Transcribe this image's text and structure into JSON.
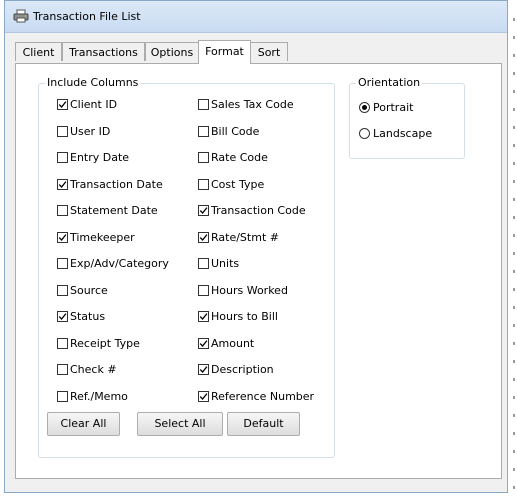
{
  "window": {
    "title": "Transaction File List"
  },
  "tabs": [
    {
      "label": "Client",
      "active": false
    },
    {
      "label": "Transactions",
      "active": false
    },
    {
      "label": "Options",
      "active": false
    },
    {
      "label": "Format",
      "active": true
    },
    {
      "label": "Sort",
      "active": false
    }
  ],
  "include_columns": {
    "legend": "Include Columns",
    "left": [
      {
        "label": "Client ID",
        "checked": true
      },
      {
        "label": "User ID",
        "checked": false
      },
      {
        "label": "Entry Date",
        "checked": false
      },
      {
        "label": "Transaction Date",
        "checked": true
      },
      {
        "label": "Statement Date",
        "checked": false
      },
      {
        "label": "Timekeeper",
        "checked": true
      },
      {
        "label": "Exp/Adv/Category",
        "checked": false
      },
      {
        "label": "Source",
        "checked": false
      },
      {
        "label": "Status",
        "checked": true
      },
      {
        "label": "Receipt Type",
        "checked": false
      },
      {
        "label": "Check #",
        "checked": false
      },
      {
        "label": "Ref./Memo",
        "checked": false
      }
    ],
    "right": [
      {
        "label": "Sales Tax Code",
        "checked": false
      },
      {
        "label": "Bill Code",
        "checked": false
      },
      {
        "label": "Rate Code",
        "checked": false
      },
      {
        "label": "Cost Type",
        "checked": false
      },
      {
        "label": "Transaction Code",
        "checked": true
      },
      {
        "label": "Rate/Stmt #",
        "checked": true
      },
      {
        "label": "Units",
        "checked": false
      },
      {
        "label": "Hours Worked",
        "checked": false
      },
      {
        "label": "Hours to Bill",
        "checked": true
      },
      {
        "label": "Amount",
        "checked": true
      },
      {
        "label": "Description",
        "checked": true
      },
      {
        "label": "Reference Number",
        "checked": true
      }
    ]
  },
  "buttons": {
    "clear_all": "Clear All",
    "select_all": "Select All",
    "default": "Default"
  },
  "orientation": {
    "legend": "Orientation",
    "options": [
      {
        "label": "Portrait",
        "selected": true
      },
      {
        "label": "Landscape",
        "selected": false
      }
    ]
  },
  "icons": {
    "app": "printer-icon",
    "checkbox_mark": "checkmark-icon"
  }
}
